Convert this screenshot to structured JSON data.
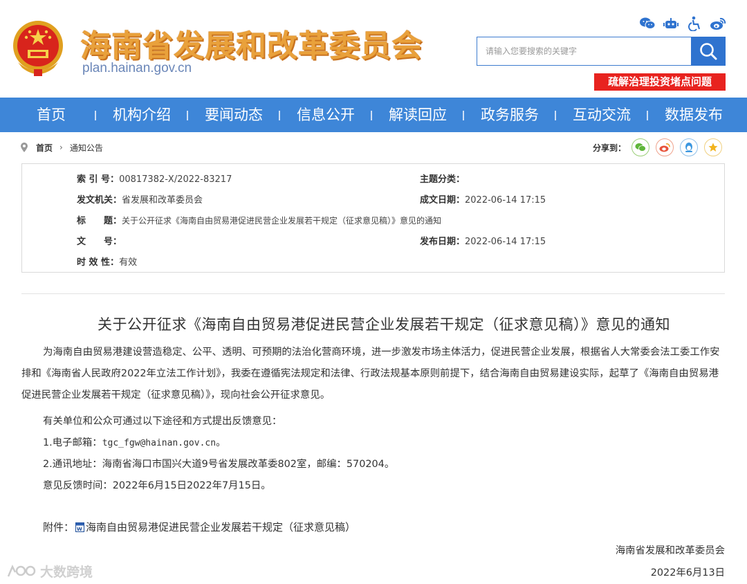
{
  "header": {
    "site_title": "海南省发展和改革委员会",
    "site_url": "plan.hainan.gov.cn",
    "top_icons": [
      "wechat-icon",
      "robot-icon",
      "accessibility-icon",
      "weibo-icon"
    ],
    "search_placeholder": "请输入您要搜索的关键字",
    "promo_banner": "疏解治理投资堵点问题"
  },
  "nav": {
    "items": [
      "首页",
      "机构介绍",
      "要闻动态",
      "信息公开",
      "解读回应",
      "政务服务",
      "互动交流",
      "数据发布"
    ]
  },
  "breadcrumb": {
    "home": "首页",
    "current": "通知公告"
  },
  "share": {
    "label": "分享到：",
    "targets": [
      "wechat-share-icon",
      "weibo-share-icon",
      "qq-share-icon",
      "favorite-star-icon"
    ]
  },
  "meta": {
    "index_label": "索 引 号：",
    "index_value": "00817382-X/2022-83217",
    "topic_label": "主题分类：",
    "topic_value": "",
    "issuer_label": "发文机关：",
    "issuer_value": "省发展和改革委员会",
    "created_label": "成文日期：",
    "created_value": "2022-06-14 17:15",
    "title_label": "标　　题：",
    "title_value": "关于公开征求《海南自由贸易港促进民营企业发展若干规定（征求意见稿）》意见的通知",
    "docno_label": "文　　号：",
    "docno_value": "",
    "published_label": "发布日期：",
    "published_value": "2022-06-14 17:15",
    "validity_label": "时 效 性：",
    "validity_value": "有效"
  },
  "article": {
    "title": "关于公开征求《海南自由贸易港促进民营企业发展若干规定（征求意见稿）》意见的通知",
    "paragraph_1": "为海南自由贸易港建设营造稳定、公平、透明、可预期的法治化营商环境，进一步激发市场主体活力，促进民营企业发展，根据省人大常委会法工委工作安排和《海南省人民政府2022年立法工作计划》，我委在遵循宪法规定和法律、行政法规基本原则前提下，结合海南自由贸易建设实际，起草了《海南自由贸易港促进民营企业发展若干规定（征求意见稿）》，现向社会公开征求意见。",
    "paragraph_2": "有关单位和公众可通过以下途径和方式提出反馈意见：",
    "email_prefix": "1.电子邮箱：",
    "email_value": "tgc_fgw@hainan.gov.cn",
    "email_suffix": "。",
    "address": "2.通讯地址：海南省海口市国兴大道9号省发展改革委802室，邮编：570204。",
    "deadline": "意见反馈时间：2022年6月15日2022年7月15日。",
    "attachment_label": "附件：",
    "attachment_link": "海南自由贸易港促进民营企业发展若干规定（征求意见稿）",
    "signature": "海南省发展和改革委员会",
    "date": "2022年6月13日"
  },
  "watermark": "大数跨境",
  "colors": {
    "nav_bg": "#3e86d8",
    "search_btn": "#2f73cf",
    "banner_red": "#e8231f",
    "title_gold": "#e9a13b"
  }
}
